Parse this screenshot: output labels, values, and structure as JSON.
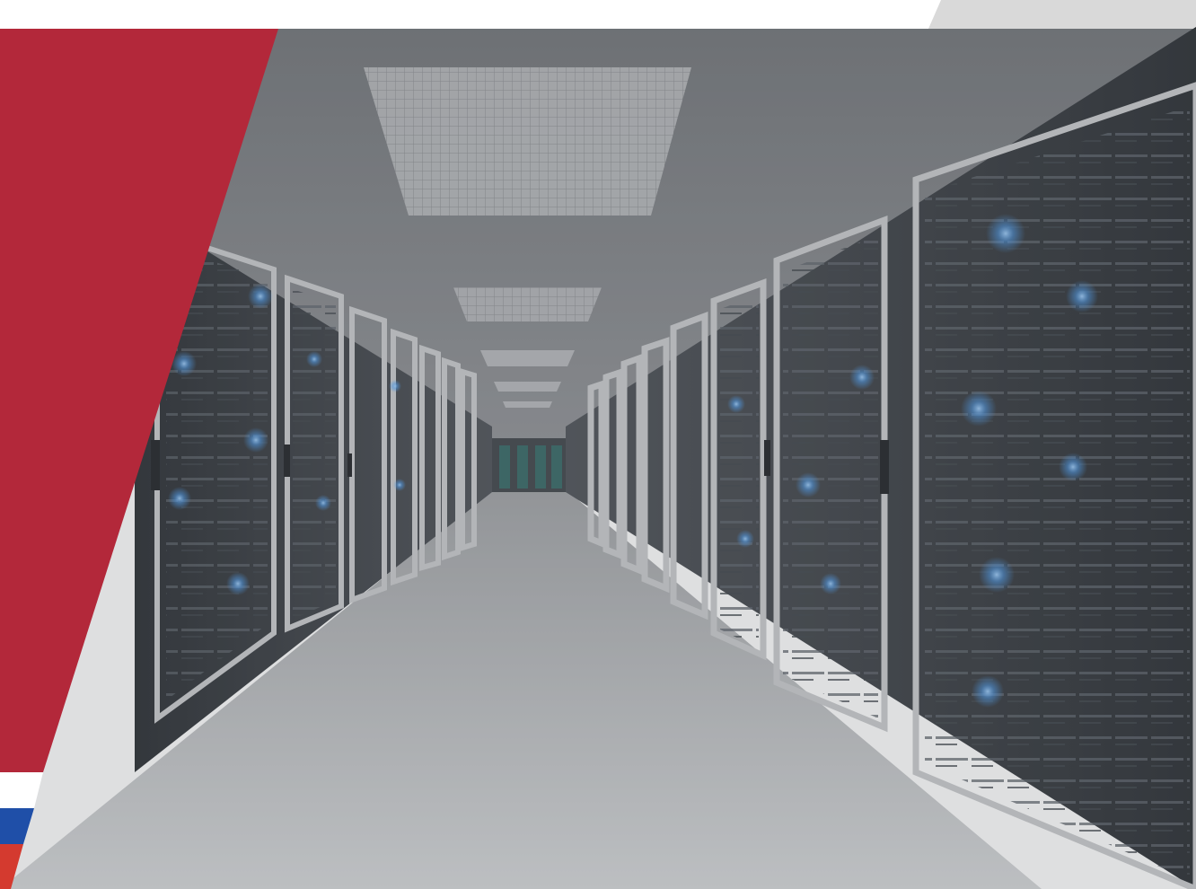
{
  "image": {
    "subject": "",
    "text": []
  },
  "colors": {
    "page_background": "#ffffff",
    "accent_red": "#b3283a",
    "flag_white": "#ffffff",
    "flag_blue": "#1f4fa8",
    "flag_red": "#d43a2f",
    "tab_gray": "#d9d9d9",
    "scene_gray": "#8b8d90",
    "floor_light": "#cfd1d3",
    "rack_dark": "#2c3036",
    "led_blue": "#4aa3ff"
  }
}
